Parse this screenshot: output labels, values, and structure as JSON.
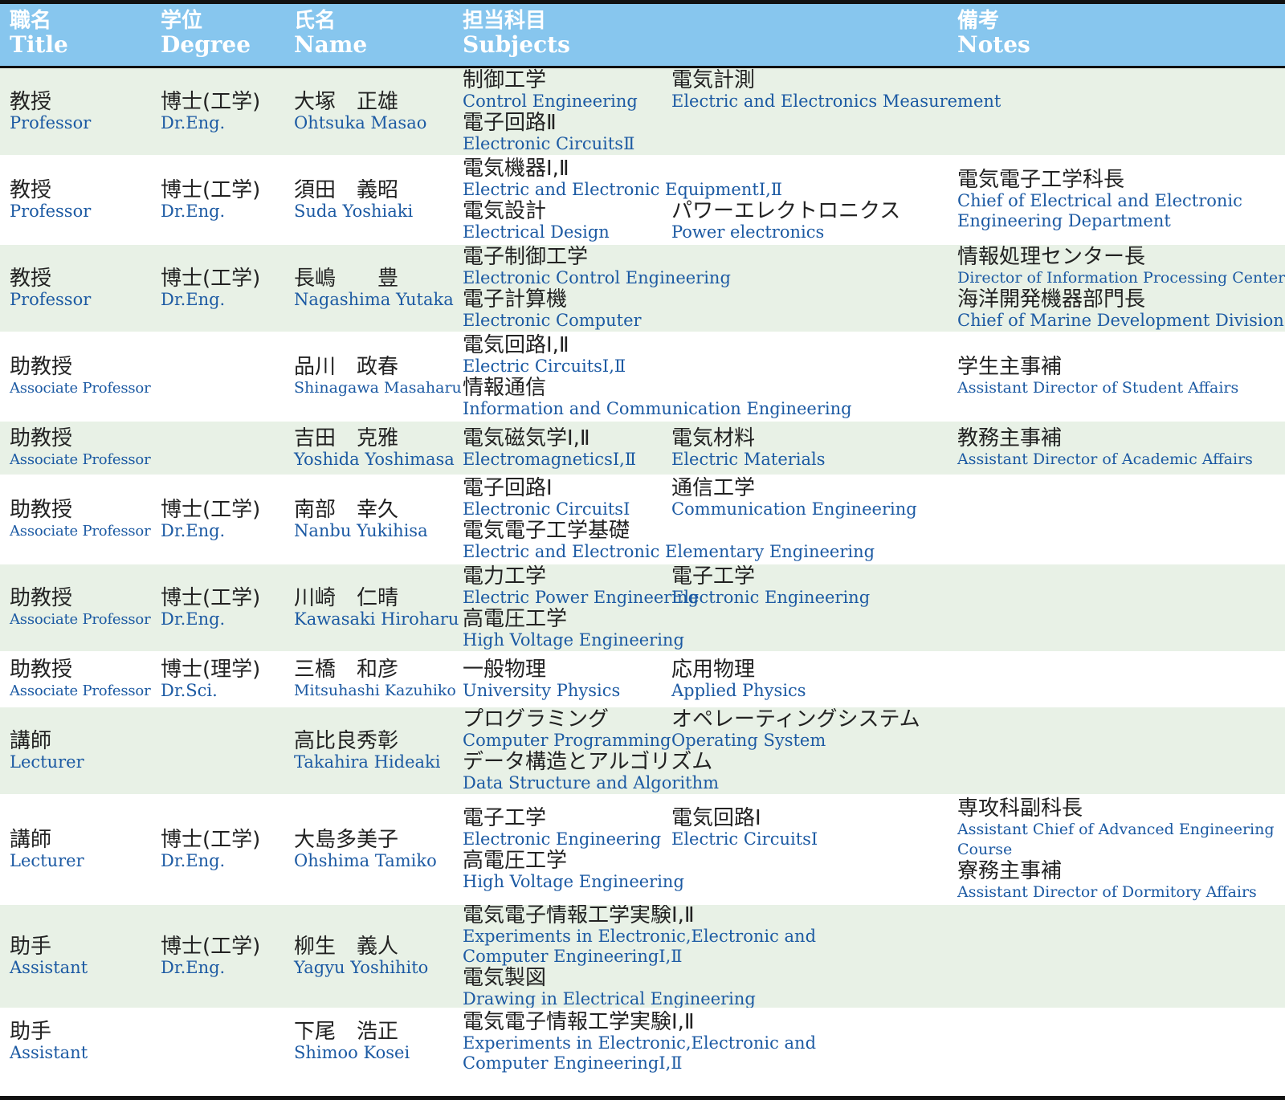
{
  "header": {
    "title": {
      "ja": "職名",
      "en": "Title"
    },
    "degree": {
      "ja": "学位",
      "en": "Degree"
    },
    "name": {
      "ja": "氏名",
      "en": "Name"
    },
    "subjects": {
      "ja": "担当科目",
      "en": "Subjects"
    },
    "notes": {
      "ja": "備考",
      "en": "Notes"
    }
  },
  "rows": [
    {
      "title": {
        "ja": "教授",
        "en": "Professor"
      },
      "degree": {
        "ja": "博士(工学)",
        "en": "Dr.Eng."
      },
      "name": {
        "ja": "大塚　正雄",
        "en": "Ohtsuka Masao"
      },
      "subject_lines": [
        [
          {
            "ja": "制御工学",
            "en": "Control Engineering"
          },
          {
            "ja": "電気計測",
            "en": "Electric and Electronics Measurement"
          }
        ],
        [
          {
            "ja": "電子回路Ⅱ",
            "en": "Electronic CircuitsⅡ"
          }
        ]
      ],
      "notes": []
    },
    {
      "title": {
        "ja": "教授",
        "en": "Professor"
      },
      "degree": {
        "ja": "博士(工学)",
        "en": "Dr.Eng."
      },
      "name": {
        "ja": "須田　義昭",
        "en": "Suda Yoshiaki"
      },
      "subject_lines": [
        [
          {
            "ja": "電気機器Ⅰ,Ⅱ",
            "en": "Electric and Electronic EquipmentⅠ,Ⅱ"
          }
        ],
        [
          {
            "ja": "電気設計",
            "en": "Electrical Design"
          },
          {
            "ja": "パワーエレクトロニクス",
            "en": "Power electronics"
          }
        ]
      ],
      "notes": [
        {
          "ja": "電気電子工学科長",
          "en": "Chief of Electrical and Electronic",
          "en2": "Engineering Department"
        }
      ]
    },
    {
      "title": {
        "ja": "教授",
        "en": "Professor"
      },
      "degree": {
        "ja": "博士(工学)",
        "en": "Dr.Eng."
      },
      "name": {
        "ja": "長嶋　　豊",
        "en": "Nagashima Yutaka"
      },
      "subject_lines": [
        [
          {
            "ja": "電子制御工学",
            "en": "Electronic Control Engineering"
          }
        ],
        [
          {
            "ja": "電子計算機",
            "en": "Electronic Computer"
          }
        ]
      ],
      "notes": [
        {
          "ja": "情報処理センター長",
          "en": "Director of Information Processing Center"
        },
        {
          "ja": "海洋開発機器部門長",
          "en": "Chief of Marine Development Division"
        }
      ]
    },
    {
      "title": {
        "ja": "助教授",
        "en": "Associate Professor"
      },
      "degree": {
        "ja": "",
        "en": ""
      },
      "name": {
        "ja": "品川　政春",
        "en": "Shinagawa Masaharu"
      },
      "subject_lines": [
        [
          {
            "ja": "電気回路Ⅰ,Ⅱ",
            "en": "Electric CircuitsⅠ,Ⅱ"
          }
        ],
        [
          {
            "ja": "情報通信",
            "en": "Information and Communication Engineering"
          }
        ]
      ],
      "notes": [
        {
          "ja": "学生主事補",
          "en": "Assistant Director of Student Affairs"
        }
      ]
    },
    {
      "title": {
        "ja": "助教授",
        "en": "Associate Professor"
      },
      "degree": {
        "ja": "",
        "en": ""
      },
      "name": {
        "ja": "吉田　克雅",
        "en": "Yoshida Yoshimasa"
      },
      "subject_lines": [
        [
          {
            "ja": "電気磁気学Ⅰ,Ⅱ",
            "en": "ElectromagneticsⅠ,Ⅱ"
          },
          {
            "ja": "電気材料",
            "en": "Electric Materials"
          }
        ]
      ],
      "notes": [
        {
          "ja": "教務主事補",
          "en": "Assistant Director of Academic Affairs"
        }
      ]
    },
    {
      "title": {
        "ja": "助教授",
        "en": "Associate Professor"
      },
      "degree": {
        "ja": "博士(工学)",
        "en": "Dr.Eng."
      },
      "name": {
        "ja": "南部　幸久",
        "en": "Nanbu Yukihisa"
      },
      "subject_lines": [
        [
          {
            "ja": "電子回路Ⅰ",
            "en": "Electronic CircuitsⅠ"
          },
          {
            "ja": "通信工学",
            "en": "Communication Engineering"
          }
        ],
        [
          {
            "ja": "電気電子工学基礎",
            "en": "Electric and Electronic Elementary Engineering"
          }
        ]
      ],
      "notes": []
    },
    {
      "title": {
        "ja": "助教授",
        "en": "Associate Professor"
      },
      "degree": {
        "ja": "博士(工学)",
        "en": "Dr.Eng."
      },
      "name": {
        "ja": "川崎　仁晴",
        "en": "Kawasaki Hiroharu"
      },
      "subject_lines": [
        [
          {
            "ja": "電力工学",
            "en": "Electric Power Engineering"
          },
          {
            "ja": "電子工学",
            "en": "Electronic Engineering"
          }
        ],
        [
          {
            "ja": "高電圧工学",
            "en": "High Voltage Engineering"
          }
        ]
      ],
      "notes": []
    },
    {
      "title": {
        "ja": "助教授",
        "en": "Associate Professor"
      },
      "degree": {
        "ja": "博士(理学)",
        "en": "Dr.Sci."
      },
      "name": {
        "ja": "三橋　和彦",
        "en": "Mitsuhashi Kazuhiko"
      },
      "subject_lines": [
        [
          {
            "ja": "一般物理",
            "en": "University Physics"
          },
          {
            "ja": "応用物理",
            "en": "Applied Physics"
          }
        ]
      ],
      "notes": []
    },
    {
      "title": {
        "ja": "講師",
        "en": "Lecturer"
      },
      "degree": {
        "ja": "",
        "en": ""
      },
      "name": {
        "ja": "高比良秀彰",
        "en": "Takahira Hideaki"
      },
      "subject_lines": [
        [
          {
            "ja": "プログラミング",
            "en": "Computer Programming"
          },
          {
            "ja": "オペレーティングシステム",
            "en": "Operating System"
          }
        ],
        [
          {
            "ja": "データ構造とアルゴリズム",
            "en": "Data Structure and Algorithm"
          }
        ]
      ],
      "notes": []
    },
    {
      "title": {
        "ja": "講師",
        "en": "Lecturer"
      },
      "degree": {
        "ja": "博士(工学)",
        "en": "Dr.Eng."
      },
      "name": {
        "ja": "大島多美子",
        "en": "Ohshima Tamiko"
      },
      "subject_lines": [
        [
          {
            "ja": "電子工学",
            "en": "Electronic Engineering"
          },
          {
            "ja": "電気回路Ⅰ",
            "en": "Electric CircuitsⅠ"
          }
        ],
        [
          {
            "ja": "高電圧工学",
            "en": "High Voltage Engineering"
          }
        ]
      ],
      "notes": [
        {
          "ja": "専攻科副科長",
          "en": "Assistant Chief of Advanced Engineering",
          "en2": "Course"
        },
        {
          "ja": "寮務主事補",
          "en": "Assistant Director of Dormitory Affairs"
        }
      ]
    },
    {
      "title": {
        "ja": "助手",
        "en": "Assistant"
      },
      "degree": {
        "ja": "博士(工学)",
        "en": "Dr.Eng."
      },
      "name": {
        "ja": "柳生　義人",
        "en": "Yagyu Yoshihito"
      },
      "subject_lines": [
        [
          {
            "ja": "電気電子情報工学実験Ⅰ,Ⅱ",
            "en": "Experiments in Electronic,Electronic and",
            "en2": "Computer EngineeringⅠ,Ⅱ"
          }
        ],
        [
          {
            "ja": "電気製図",
            "en": "Drawing in Electrical Engineering"
          }
        ]
      ],
      "notes": []
    },
    {
      "title": {
        "ja": "助手",
        "en": "Assistant"
      },
      "degree": {
        "ja": "",
        "en": ""
      },
      "name": {
        "ja": "下尾　浩正",
        "en": "Shimoo Kosei"
      },
      "subject_lines": [
        [
          {
            "ja": "電気電子情報工学実験Ⅰ,Ⅱ",
            "en": "Experiments in Electronic,Electronic and",
            "en2": "Computer EngineeringⅠ,Ⅱ"
          }
        ]
      ],
      "notes": []
    }
  ]
}
